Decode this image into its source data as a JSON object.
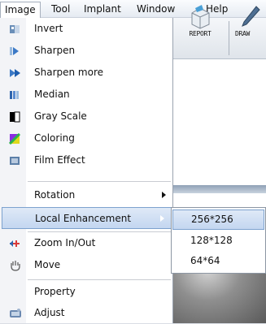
{
  "menubar": [
    "Image",
    "Tool",
    "Implant",
    "Window",
    "Help"
  ],
  "toolbar": {
    "report_label": "REPORT",
    "draw_label": "DRAW"
  },
  "menu": {
    "items": [
      {
        "label": "Invert",
        "icon": "invert-icon"
      },
      {
        "label": "Sharpen",
        "icon": "sharpen-icon"
      },
      {
        "label": "Sharpen more",
        "icon": "sharpen-more-icon"
      },
      {
        "label": "Median",
        "icon": "median-icon"
      },
      {
        "label": "Gray Scale",
        "icon": "gray-scale-icon"
      },
      {
        "label": "Coloring",
        "icon": "coloring-icon"
      },
      {
        "label": "Film Effect",
        "icon": "film-effect-icon"
      },
      {
        "label": "Rotation",
        "icon": "",
        "submenu": true
      },
      {
        "label": "Local Enhancement",
        "icon": "",
        "submenu": true,
        "highlighted": true
      },
      {
        "label": "Zoom In/Out",
        "icon": "zoom-icon"
      },
      {
        "label": "Move",
        "icon": "hand-icon"
      },
      {
        "label": "Property",
        "icon": ""
      },
      {
        "label": "Adjust",
        "icon": "adjust-icon"
      }
    ]
  },
  "submenu": {
    "items": [
      "256*256",
      "128*128",
      "64*64"
    ],
    "highlighted_index": 0
  },
  "colors": {
    "highlight_border": "#7da2ce",
    "highlight_fill": "#c3d6f0"
  }
}
